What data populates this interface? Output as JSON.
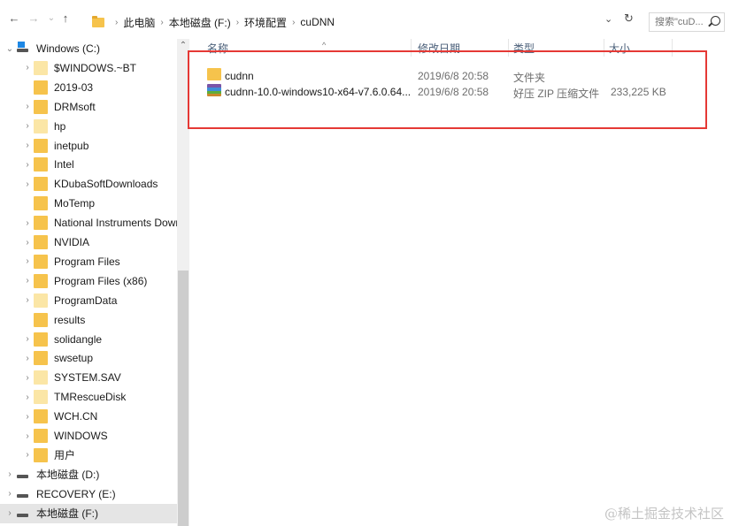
{
  "toolbar": {
    "back_glyph": "←",
    "forward_glyph": "→",
    "recent_glyph": "⌄",
    "up_glyph": "↑",
    "breadcrumb": [
      "此电脑",
      "本地磁盘 (F:)",
      "环境配置",
      "cuDNN"
    ],
    "sep_glyph": "›",
    "dropdown_glyph": "⌄",
    "refresh_glyph": "↻",
    "search_placeholder": "搜索\"cuD...",
    "icons": [
      "back-arrow-icon",
      "forward-arrow-icon",
      "recent-locations-icon",
      "up-arrow-icon",
      "folder-icon",
      "chevron-down-icon",
      "refresh-icon",
      "search-icon"
    ]
  },
  "nav": {
    "collapse_glyph": "⌄",
    "expand_glyph": "›",
    "scroll_up_glyph": "⌃",
    "items": [
      {
        "label": "Windows (C:)",
        "icon": "windows-drive-icon",
        "chevron": "⌄"
      },
      {
        "label": "$WINDOWS.~BT",
        "icon": "folder-pale-icon",
        "chevron": "›"
      },
      {
        "label": "2019-03",
        "icon": "folder-icon",
        "chevron": ""
      },
      {
        "label": "DRMsoft",
        "icon": "folder-icon",
        "chevron": "›"
      },
      {
        "label": "hp",
        "icon": "folder-pale-icon",
        "chevron": "›"
      },
      {
        "label": "inetpub",
        "icon": "folder-icon",
        "chevron": "›"
      },
      {
        "label": "Intel",
        "icon": "folder-icon",
        "chevron": "›"
      },
      {
        "label": "KDubaSoftDownloads",
        "icon": "folder-icon",
        "chevron": "›"
      },
      {
        "label": "MoTemp",
        "icon": "folder-icon",
        "chevron": ""
      },
      {
        "label": "National Instruments Dowr",
        "icon": "folder-icon",
        "chevron": "›"
      },
      {
        "label": "NVIDIA",
        "icon": "folder-icon",
        "chevron": "›"
      },
      {
        "label": "Program Files",
        "icon": "folder-icon",
        "chevron": "›"
      },
      {
        "label": "Program Files (x86)",
        "icon": "folder-icon",
        "chevron": "›"
      },
      {
        "label": "ProgramData",
        "icon": "folder-pale-icon",
        "chevron": "›"
      },
      {
        "label": "results",
        "icon": "folder-icon",
        "chevron": ""
      },
      {
        "label": "solidangle",
        "icon": "folder-icon",
        "chevron": "›"
      },
      {
        "label": "swsetup",
        "icon": "folder-icon",
        "chevron": "›"
      },
      {
        "label": "SYSTEM.SAV",
        "icon": "folder-pale-icon",
        "chevron": "›"
      },
      {
        "label": "TMRescueDisk",
        "icon": "folder-pale-icon",
        "chevron": "›"
      },
      {
        "label": "WCH.CN",
        "icon": "folder-icon",
        "chevron": "›"
      },
      {
        "label": "WINDOWS",
        "icon": "folder-icon",
        "chevron": "›"
      },
      {
        "label": "用户",
        "icon": "folder-icon",
        "chevron": "›"
      },
      {
        "label": "本地磁盘 (D:)",
        "icon": "drive-icon",
        "chevron": "›"
      },
      {
        "label": "RECOVERY (E:)",
        "icon": "drive-icon",
        "chevron": "›"
      },
      {
        "label": "本地磁盘 (F:)",
        "icon": "drive-icon",
        "chevron": "›",
        "selected": true
      }
    ]
  },
  "content": {
    "sort_glyph": "^",
    "columns": {
      "name": "名称",
      "date": "修改日期",
      "type": "类型",
      "size": "大小"
    },
    "rows": [
      {
        "name": "cudnn",
        "date": "2019/6/8 20:58",
        "type": "文件夹",
        "size": "",
        "icon": "folder-icon"
      },
      {
        "name": "cudnn-10.0-windows10-x64-v7.6.0.64....",
        "date": "2019/6/8 20:58",
        "type": "好压 ZIP 压缩文件",
        "size": "233,225 KB",
        "icon": "zip-archive-icon"
      }
    ]
  },
  "watermark": "@稀土掘金技术社区",
  "colors": {
    "highlight": "#e53935",
    "folder": "#f6c34c",
    "selected_bg": "#e5e5e5",
    "header_text": "#4c607a"
  }
}
